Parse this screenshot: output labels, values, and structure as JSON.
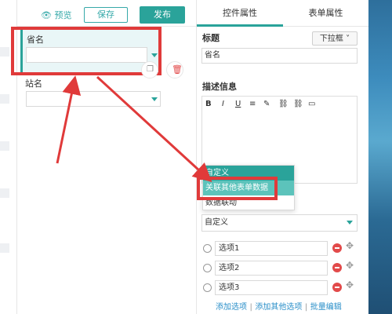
{
  "toolbar": {
    "preview_label": "预览",
    "save_label": "保存",
    "publish_label": "发布"
  },
  "canvas": {
    "fields": [
      {
        "label": "省名"
      },
      {
        "label": "站名"
      }
    ]
  },
  "panel": {
    "tabs": [
      {
        "label": "控件属性"
      },
      {
        "label": "表单属性"
      }
    ],
    "title_section": {
      "heading": "标题",
      "type_select": "下拉框 ˅",
      "title_value": "省名"
    },
    "desc_section": {
      "heading": "描述信息",
      "toolbar": [
        "B",
        "I",
        "U",
        "≡",
        "✎",
        "⛓",
        "⛓",
        "▭"
      ]
    },
    "dropdown": {
      "items": [
        "自定义",
        "关联其他表单数据",
        "数据联动"
      ]
    },
    "option_source_value": "自定义",
    "options": [
      "选项1",
      "选项2",
      "选项3"
    ],
    "links": {
      "add_option": "添加选项",
      "add_other": "添加其他选项",
      "batch_edit": "批量编辑",
      "sep": "|"
    }
  },
  "colors": {
    "accent": "#2aa39a",
    "highlight_red": "#e03a3a",
    "link": "#2a8fc9"
  }
}
